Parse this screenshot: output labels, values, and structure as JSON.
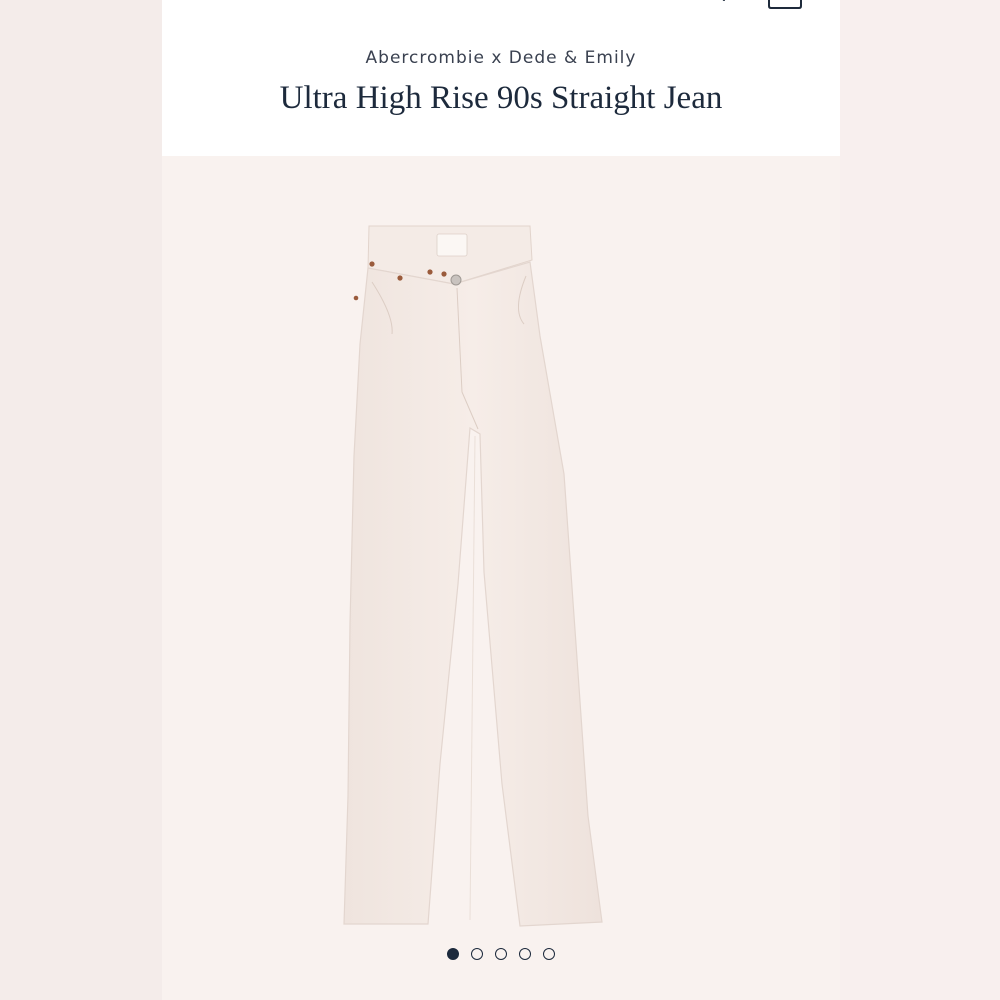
{
  "header": {
    "icons": {
      "menu": "hamburger-menu-icon",
      "search": "search-icon",
      "bag": "shopping-bag-icon"
    }
  },
  "product": {
    "brand": "Abercrombie x Dede & Emily",
    "title": "Ultra High Rise 90s Straight Jean",
    "image": "white-straight-jeans",
    "color": "#f3e9e4"
  },
  "carousel": {
    "total_images": 5,
    "active_index": 0
  },
  "colors": {
    "text_dark": "#1d2a3c",
    "background": "#f9f2ef"
  }
}
